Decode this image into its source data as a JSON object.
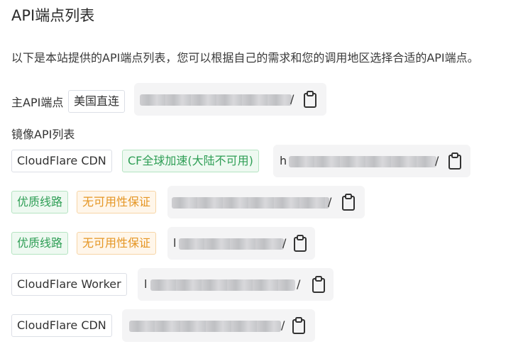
{
  "title": "API端点列表",
  "description": "以下是本站提供的API端点列表，您可以根据自己的需求和您的调用地区选择合适的API端点。",
  "main_endpoint": {
    "label": "主API端点",
    "tag": "美国直连",
    "visible_end": "/"
  },
  "mirror_heading": "镜像API列表",
  "mirrors": [
    {
      "tags": [
        "CloudFlare CDN",
        "CF全球加速(大陆不可用)"
      ],
      "visible_start": "h",
      "visible_end": "/"
    },
    {
      "tags": [
        "优质线路",
        "无可用性保证"
      ],
      "visible_end": "/"
    },
    {
      "tags": [
        "优质线路",
        "无可用性保证"
      ],
      "visible_start": "l",
      "visible_end": "/"
    },
    {
      "tags": [
        "CloudFlare Worker"
      ],
      "visible_start": "l",
      "visible_end": "/"
    },
    {
      "tags": [
        "CloudFlare CDN"
      ],
      "visible_end": "/"
    }
  ],
  "copy_icon": "clipboard-icon",
  "colors": {
    "tag_green_text": "#2e9e55",
    "tag_orange_text": "#e59624",
    "endpoint_bg": "#f4f4f5"
  }
}
